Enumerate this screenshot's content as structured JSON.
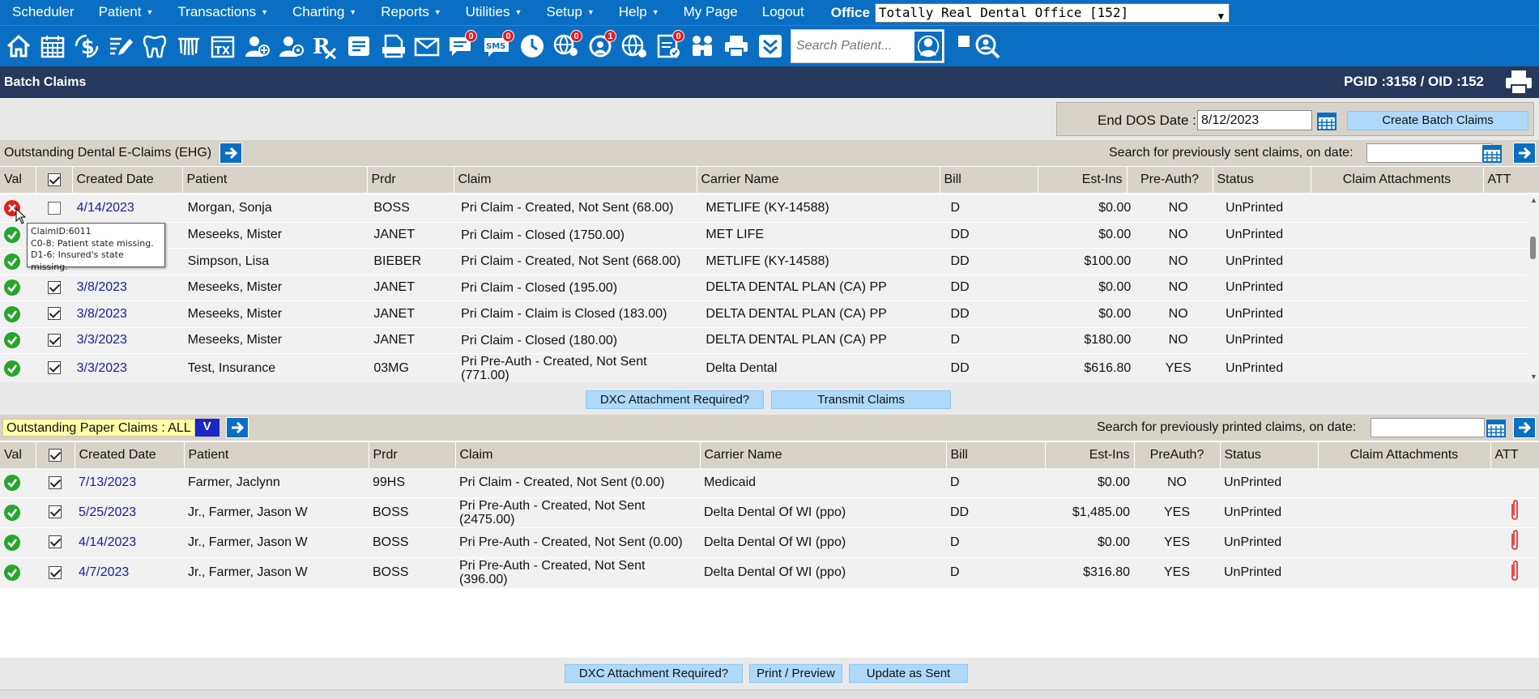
{
  "menu": {
    "items": [
      {
        "label": "Scheduler",
        "caret": false
      },
      {
        "label": "Patient",
        "caret": true
      },
      {
        "label": "Transactions",
        "caret": true
      },
      {
        "label": "Charting",
        "caret": true
      },
      {
        "label": "Reports",
        "caret": true
      },
      {
        "label": "Utilities",
        "caret": true
      },
      {
        "label": "Setup",
        "caret": true
      },
      {
        "label": "Help",
        "caret": true
      },
      {
        "label": "My Page",
        "caret": false
      },
      {
        "label": "Logout",
        "caret": false
      }
    ],
    "office_label": "Office",
    "office_value": "Totally Real Dental Office [152]"
  },
  "toolbar": {
    "badges": {
      "messages": "0",
      "sms": "0",
      "web": "0",
      "alerts": "1",
      "forms": "0"
    },
    "sms_label": "SMS",
    "search_placeholder": "Search Patient..."
  },
  "title": {
    "page": "Batch Claims",
    "pgid": "PGID :3158  /  OID :152"
  },
  "enddos": {
    "label": "End DOS Date :",
    "value": "8/12/2023",
    "create_button": "Create Batch Claims"
  },
  "ehg": {
    "title": "Outstanding Dental E-Claims (EHG)",
    "search_label": "Search for previously sent claims, on date:",
    "columns": [
      "Val",
      "",
      "Created Date",
      "Patient",
      "Prdr",
      "Claim",
      "Carrier Name",
      "Bill",
      "Est-Ins",
      "Pre-Auth?",
      "Status",
      "Claim Attachments",
      "ATT"
    ],
    "rows": [
      {
        "valid": false,
        "checked": false,
        "date": "4/14/2023",
        "patient": "Morgan, Sonja",
        "prdr": "BOSS",
        "claim": "Pri Claim - Created, Not Sent (68.00)",
        "carrier": "METLIFE (KY-14588)",
        "bill": "D",
        "est": "$0.00",
        "preauth": "NO",
        "status": "UnPrinted"
      },
      {
        "valid": true,
        "checked": true,
        "date": "3/8/2023",
        "patient": "Meseeks, Mister",
        "prdr": "JANET",
        "claim": "Pri Claim - Closed (1750.00)",
        "carrier": "MET LIFE",
        "bill": "DD",
        "est": "$0.00",
        "preauth": "NO",
        "status": "UnPrinted"
      },
      {
        "valid": true,
        "checked": true,
        "date": "3/8/2023",
        "patient": "Simpson, Lisa",
        "prdr": "BIEBER",
        "claim": "Pri Claim - Created, Not Sent (668.00)",
        "carrier": "METLIFE (KY-14588)",
        "bill": "DD",
        "est": "$100.00",
        "preauth": "NO",
        "status": "UnPrinted"
      },
      {
        "valid": true,
        "checked": true,
        "date": "3/8/2023",
        "patient": "Meseeks, Mister",
        "prdr": "JANET",
        "claim": "Pri Claim - Closed (195.00)",
        "carrier": "DELTA DENTAL PLAN (CA) PP",
        "bill": "DD",
        "est": "$0.00",
        "preauth": "NO",
        "status": "UnPrinted"
      },
      {
        "valid": true,
        "checked": true,
        "date": "3/8/2023",
        "patient": "Meseeks, Mister",
        "prdr": "JANET",
        "claim": "Pri Claim - Claim is Closed (183.00)",
        "carrier": "DELTA DENTAL PLAN (CA) PP",
        "bill": "DD",
        "est": "$0.00",
        "preauth": "NO",
        "status": "UnPrinted"
      },
      {
        "valid": true,
        "checked": true,
        "date": "3/3/2023",
        "patient": "Meseeks, Mister",
        "prdr": "JANET",
        "claim": "Pri Claim - Closed (180.00)",
        "carrier": "DELTA DENTAL PLAN (CA) PP",
        "bill": "D",
        "est": "$180.00",
        "preauth": "NO",
        "status": "UnPrinted"
      },
      {
        "valid": true,
        "checked": true,
        "date": "3/3/2023",
        "patient": "Test, Insurance",
        "prdr": "03MG",
        "claim": "Pri Pre-Auth - Created, Not Sent (771.00)",
        "carrier": "Delta Dental",
        "bill": "DD",
        "est": "$616.80",
        "preauth": "YES",
        "status": "UnPrinted"
      }
    ],
    "buttons": {
      "dxc": "DXC Attachment Required?",
      "transmit": "Transmit Claims"
    }
  },
  "tooltip": {
    "line1": "ClaimID:6011",
    "line2": "C0-8: Patient state missing.",
    "line3": "D1-6:  Insured's state missing."
  },
  "paper": {
    "title": "Outstanding Paper Claims : ALL",
    "v_label": "V",
    "search_label": "Search for previously printed claims, on date:",
    "columns": [
      "Val",
      "",
      "Created Date",
      "Patient",
      "Prdr",
      "Claim",
      "Carrier Name",
      "Bill",
      "Est-Ins",
      "PreAuth?",
      "Status",
      "Claim Attachments",
      "ATT"
    ],
    "rows": [
      {
        "valid": true,
        "checked": true,
        "date": "7/13/2023",
        "patient": "Farmer, Jaclynn",
        "prdr": "99HS",
        "claim": "Pri Claim - Created, Not Sent (0.00)",
        "carrier": "Medicaid",
        "bill": "D",
        "est": "$0.00",
        "preauth": "NO",
        "status": "UnPrinted",
        "clip": false
      },
      {
        "valid": true,
        "checked": true,
        "date": "5/25/2023",
        "patient": "Jr., Farmer, Jason W",
        "prdr": "BOSS",
        "claim": "Pri Pre-Auth - Created, Not Sent (2475.00)",
        "carrier": "Delta Dental Of WI (ppo)",
        "bill": "DD",
        "est": "$1,485.00",
        "preauth": "YES",
        "status": "UnPrinted",
        "clip": true
      },
      {
        "valid": true,
        "checked": true,
        "date": "4/14/2023",
        "patient": "Jr., Farmer, Jason W",
        "prdr": "BOSS",
        "claim": "Pri Pre-Auth - Created, Not Sent (0.00)",
        "carrier": "Delta Dental Of WI (ppo)",
        "bill": "D",
        "est": "$0.00",
        "preauth": "YES",
        "status": "UnPrinted",
        "clip": true
      },
      {
        "valid": true,
        "checked": true,
        "date": "4/7/2023",
        "patient": "Jr., Farmer, Jason W",
        "prdr": "BOSS",
        "claim": "Pri Pre-Auth - Created, Not Sent (396.00)",
        "carrier": "Delta Dental Of WI (ppo)",
        "bill": "D",
        "est": "$316.80",
        "preauth": "YES",
        "status": "UnPrinted",
        "clip": true
      }
    ],
    "buttons": {
      "dxc": "DXC Attachment Required?",
      "print": "Print / Preview",
      "update": "Update as Sent"
    }
  },
  "colors": {
    "menu_blue": "#0a6fc2",
    "title_navy": "#24395b",
    "header_tan": "#d8d3c8",
    "button_blue": "#aed9fb",
    "valid_green": "#27a52e",
    "invalid_red": "#e22020"
  }
}
